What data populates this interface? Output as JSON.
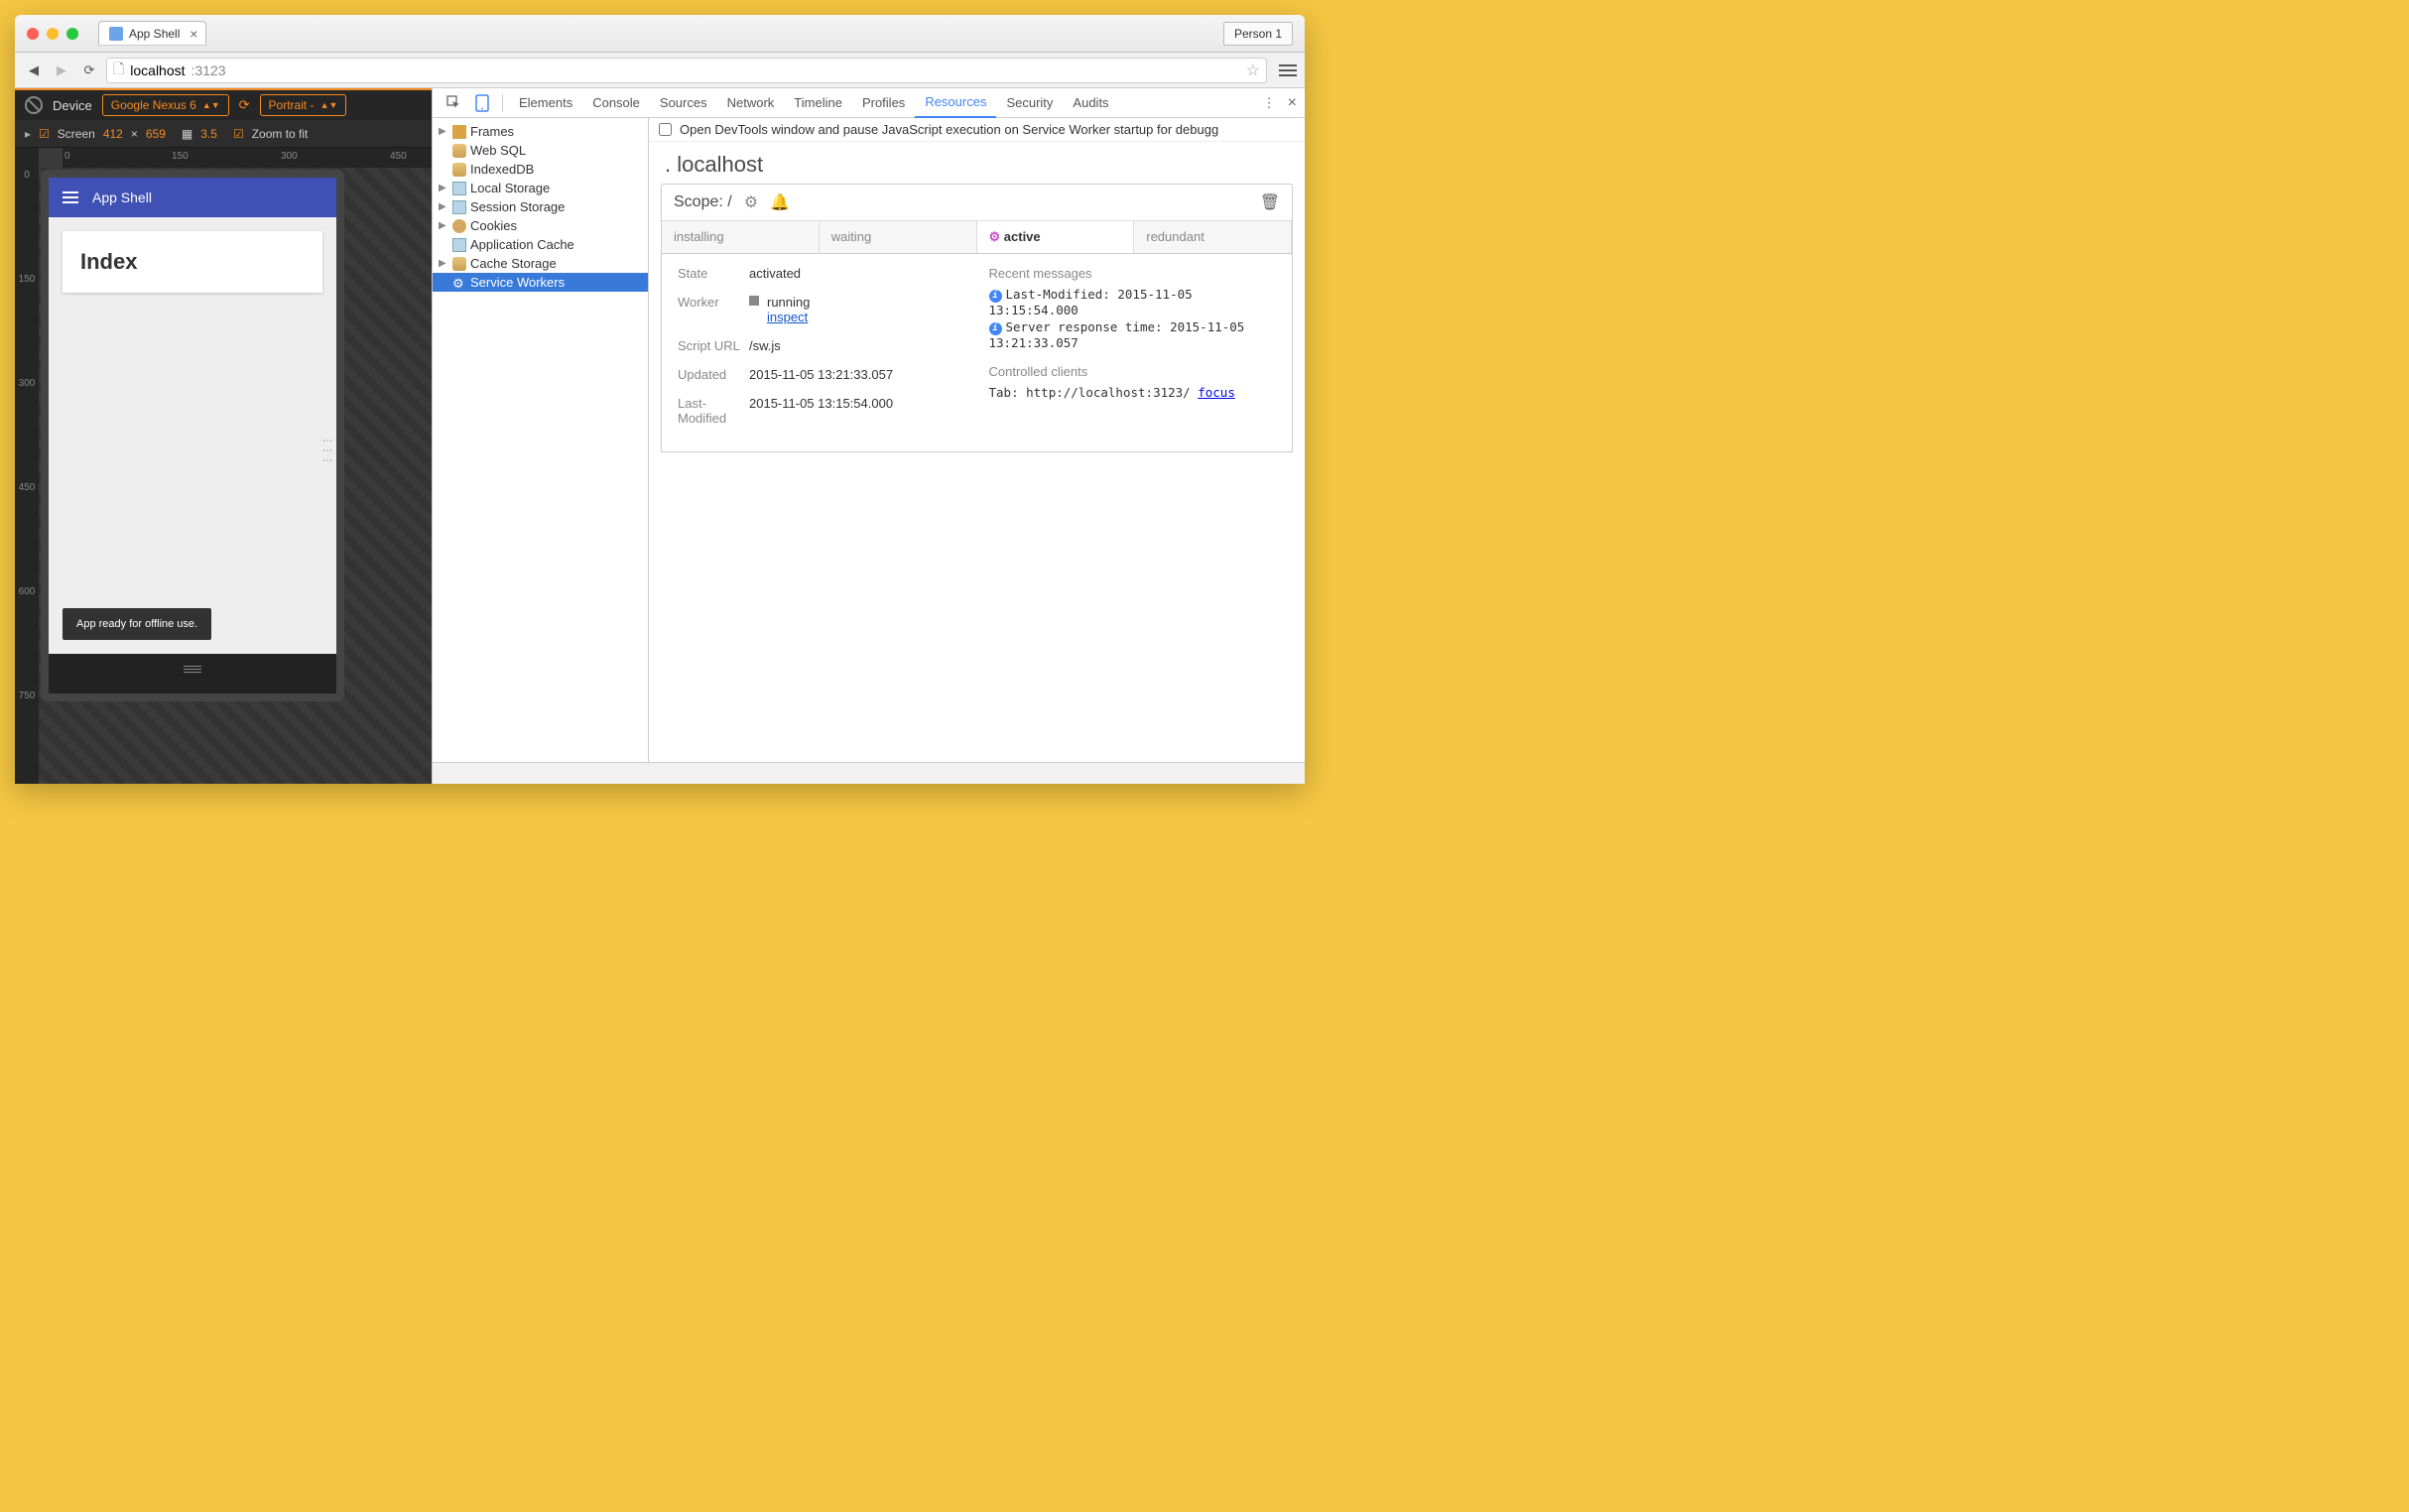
{
  "browser": {
    "tab_title": "App Shell",
    "profile": "Person 1",
    "url_host": "localhost",
    "url_port": ":3123"
  },
  "device_toolbar": {
    "device_label": "Device",
    "device_name": "Google Nexus 6",
    "orientation": "Portrait -",
    "screen_label": "Screen",
    "width": "412",
    "sep": "×",
    "height": "659",
    "dpr": "3.5",
    "zoom_label": "Zoom to fit",
    "ruler_h": [
      "0",
      "150",
      "300",
      "450"
    ],
    "ruler_v": [
      "0",
      "150",
      "300",
      "450",
      "600",
      "750"
    ]
  },
  "app": {
    "title": "App Shell",
    "card_heading": "Index",
    "toast": "App ready for offline use."
  },
  "devtools": {
    "tabs": [
      "Elements",
      "Console",
      "Sources",
      "Network",
      "Timeline",
      "Profiles",
      "Resources",
      "Security",
      "Audits"
    ],
    "resources_tree": [
      {
        "label": "Frames",
        "icon": "folder",
        "expand": true
      },
      {
        "label": "Web SQL",
        "icon": "db"
      },
      {
        "label": "IndexedDB",
        "icon": "db"
      },
      {
        "label": "Local Storage",
        "icon": "grid",
        "expand": true
      },
      {
        "label": "Session Storage",
        "icon": "grid",
        "expand": true
      },
      {
        "label": "Cookies",
        "icon": "cookie",
        "expand": true
      },
      {
        "label": "Application Cache",
        "icon": "grid"
      },
      {
        "label": "Cache Storage",
        "icon": "db",
        "expand": true
      },
      {
        "label": "Service Workers",
        "icon": "gear",
        "selected": true
      }
    ],
    "sw": {
      "checkbox_label": "Open DevTools window and pause JavaScript execution on Service Worker startup for debugg",
      "host": "localhost",
      "scope_label": "Scope: /",
      "tabs": [
        "installing",
        "waiting",
        "active",
        "redundant"
      ],
      "state_label": "State",
      "state_value": "activated",
      "worker_label": "Worker",
      "worker_status": "running",
      "worker_inspect": "inspect",
      "script_label": "Script URL",
      "script_value": "/sw.js",
      "updated_label": "Updated",
      "updated_value": "2015-11-05 13:21:33.057",
      "modified_label": "Last-Modified",
      "modified_value": "2015-11-05 13:15:54.000",
      "recent_label": "Recent messages",
      "msg1": "Last-Modified: 2015-11-05 13:15:54.000",
      "msg2": "Server response time: 2015-11-05 13:21:33.057",
      "clients_label": "Controlled clients",
      "client_prefix": "Tab: http://localhost:3123/ ",
      "client_link": "focus"
    }
  }
}
